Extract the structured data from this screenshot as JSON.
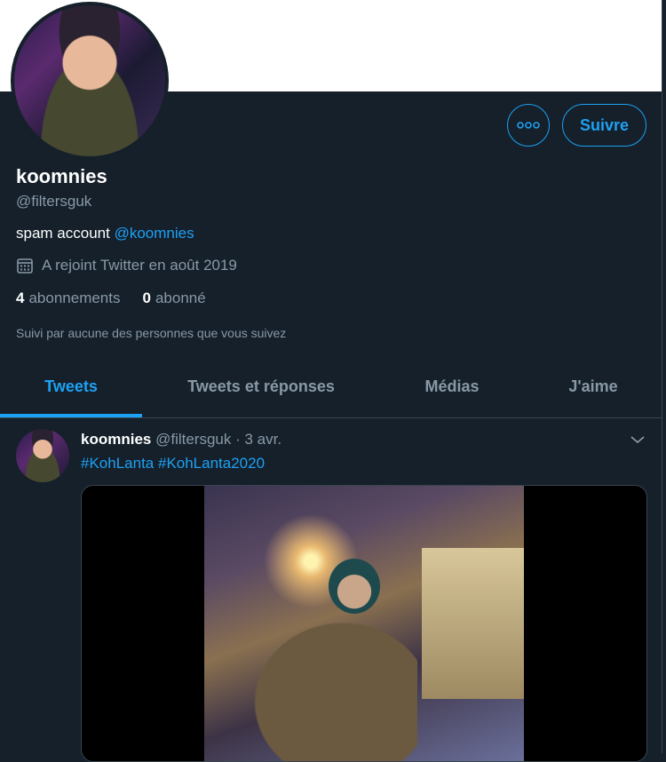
{
  "profile": {
    "name": "koomnies",
    "handle": "@filtersguk",
    "bio_text": "spam account ",
    "bio_mention": "@koomnies",
    "joined": "A rejoint Twitter en août 2019",
    "following_count": "4",
    "following_label": "abonnements",
    "followers_count": "0",
    "followers_label": "abonné",
    "followed_by": "Suivi par aucune des personnes que vous suivez"
  },
  "actions": {
    "more_icon": "more-icon",
    "follow_label": "Suivre"
  },
  "tabs": [
    {
      "label": "Tweets",
      "active": true
    },
    {
      "label": "Tweets et réponses",
      "active": false
    },
    {
      "label": "Médias",
      "active": false
    },
    {
      "label": "J'aime",
      "active": false
    }
  ],
  "tweet": {
    "name": "koomnies",
    "handle": "@filtersguk",
    "separator": " · ",
    "date": "3 avr.",
    "hashtag1": "#KohLanta",
    "hashtag2": "#KohLanta2020"
  },
  "colors": {
    "background": "#15202b",
    "accent": "#1da1f2",
    "secondary_text": "#8899a6",
    "border": "#38444d"
  }
}
